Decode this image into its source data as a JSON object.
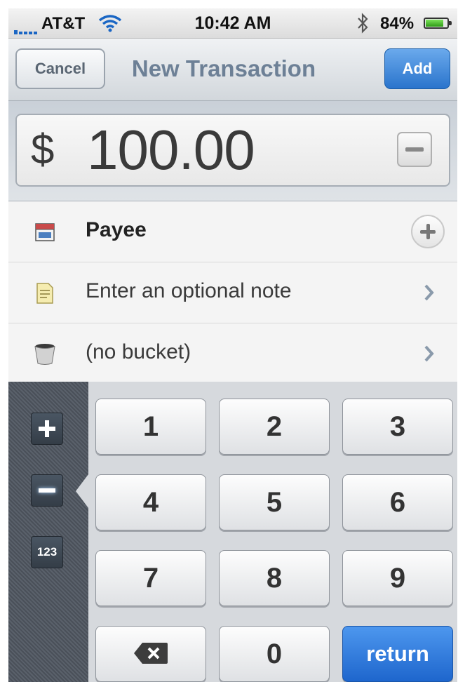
{
  "status_bar": {
    "carrier": "AT&T",
    "time": "10:42 AM",
    "battery_percent": "84%",
    "battery_level": 0.84
  },
  "nav": {
    "cancel_label": "Cancel",
    "title": "New Transaction",
    "add_label": "Add"
  },
  "amount": {
    "currency": "$",
    "value": "100.00"
  },
  "rows": {
    "payee": {
      "label": "Payee",
      "icon": "store-icon"
    },
    "note": {
      "label": "Enter an optional note",
      "icon": "note-icon"
    },
    "bucket": {
      "label": "(no bucket)",
      "icon": "bucket-icon"
    }
  },
  "keypad": {
    "side": {
      "numbers_label": "123"
    },
    "keys": [
      "1",
      "2",
      "3",
      "4",
      "5",
      "6",
      "7",
      "8",
      "9",
      "0"
    ],
    "return_label": "return"
  },
  "colors": {
    "accent": "#2a74cc",
    "title": "#6d8096"
  }
}
